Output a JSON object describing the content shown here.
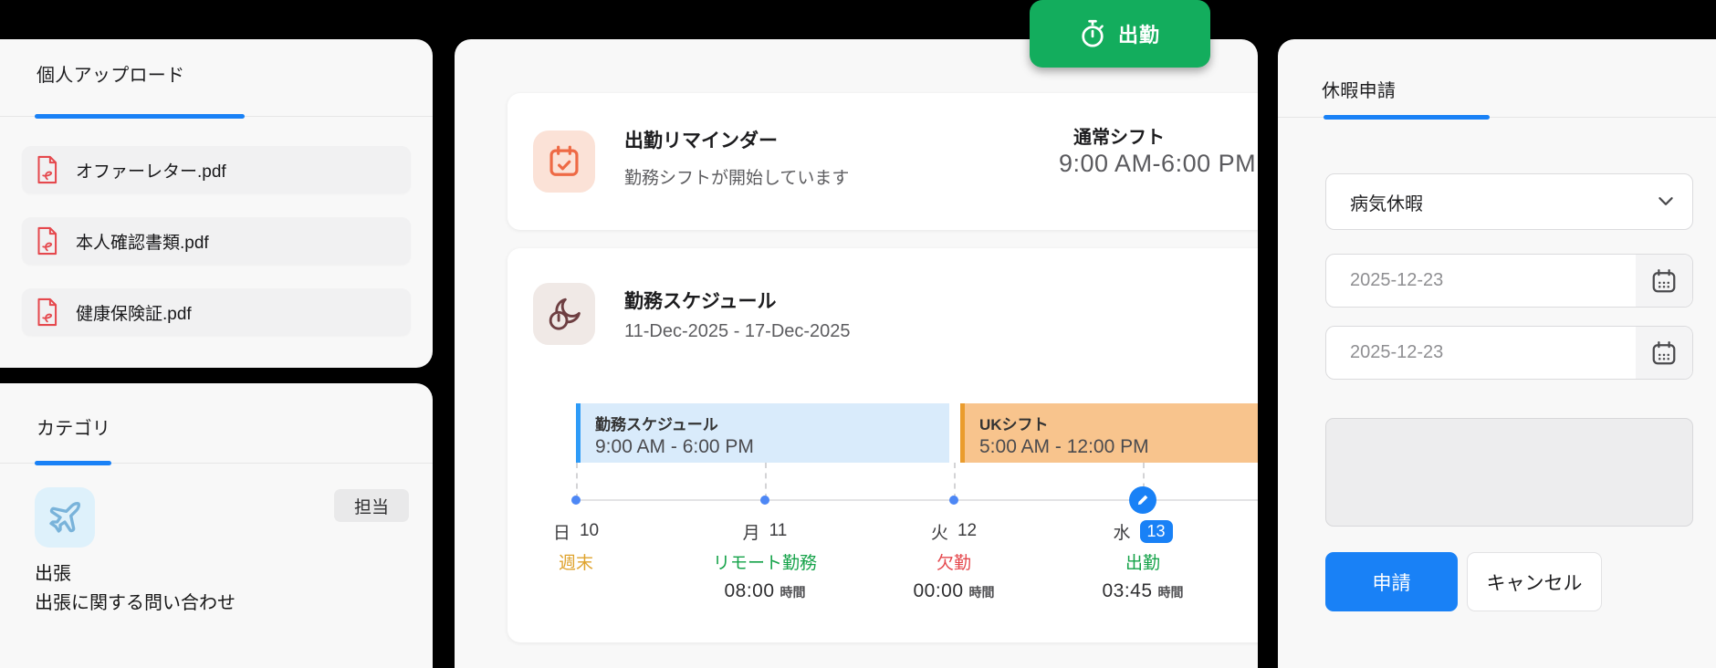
{
  "colors": {
    "accent_blue": "#1981F6",
    "clock_in_green": "#13AD5D",
    "status_green": "#16A34A",
    "status_red": "#E5484D",
    "status_orange": "#DFA32E",
    "shift_blue_fill": "#D9EBFB",
    "shift_blue_border": "#2E9BF7",
    "shift_orange_fill": "#F8C48D",
    "shift_orange_border": "#EA9C2D",
    "pdf_red": "#E5484D"
  },
  "personal_upload": {
    "title": "個人アップロード",
    "files": [
      {
        "name": "オファーレター.pdf",
        "icon": "pdf-file-icon"
      },
      {
        "name": "本人確認書類.pdf",
        "icon": "pdf-file-icon"
      },
      {
        "name": "健康保険証.pdf",
        "icon": "pdf-file-icon"
      }
    ]
  },
  "category": {
    "title": "カテゴリ",
    "badge": "担当",
    "item_icon": "airplane-icon",
    "item_title": "出張",
    "item_desc": "出張に関する問い合わせ"
  },
  "clock_in": {
    "label": "出勤",
    "icon": "stopwatch-icon"
  },
  "reminder": {
    "icon": "calendar-check-icon",
    "title": "出勤リマインダー",
    "subtitle": "勤務シフトが開始しています",
    "shift_name": "通常シフト",
    "shift_time": "9:00 AM-6:00 PM"
  },
  "schedule": {
    "icon": "shift-clock-icon",
    "title": "勤務スケジュール",
    "date_range": "11-Dec-2025 - 17-Dec-2025",
    "shifts": [
      {
        "name": "勤務スケジュール",
        "time": "9:00 AM - 6:00 PM",
        "color": "blue"
      },
      {
        "name": "UKシフト",
        "time": "5:00 AM - 12:00 PM",
        "color": "orange"
      }
    ],
    "days": [
      {
        "dow": "日",
        "date": "10",
        "status": "週末",
        "status_color": "orange",
        "hours": null,
        "hours_unit": null
      },
      {
        "dow": "月",
        "date": "11",
        "status": "リモート勤務",
        "status_color": "green",
        "hours": "08:00",
        "hours_unit": "時間"
      },
      {
        "dow": "火",
        "date": "12",
        "status": "欠勤",
        "status_color": "red",
        "hours": "00:00",
        "hours_unit": "時間"
      },
      {
        "dow": "水",
        "date": "13",
        "status": "出勤",
        "status_color": "green",
        "hours": "03:45",
        "hours_unit": "時間",
        "selected": true,
        "marker": "edit-pencil-icon"
      }
    ]
  },
  "leave_form": {
    "title": "休暇申請",
    "leave_type": "病気休暇",
    "start_date": "2025-12-23",
    "end_date": "2025-12-23",
    "comment": "",
    "submit_label": "申請",
    "cancel_label": "キャンセル"
  }
}
